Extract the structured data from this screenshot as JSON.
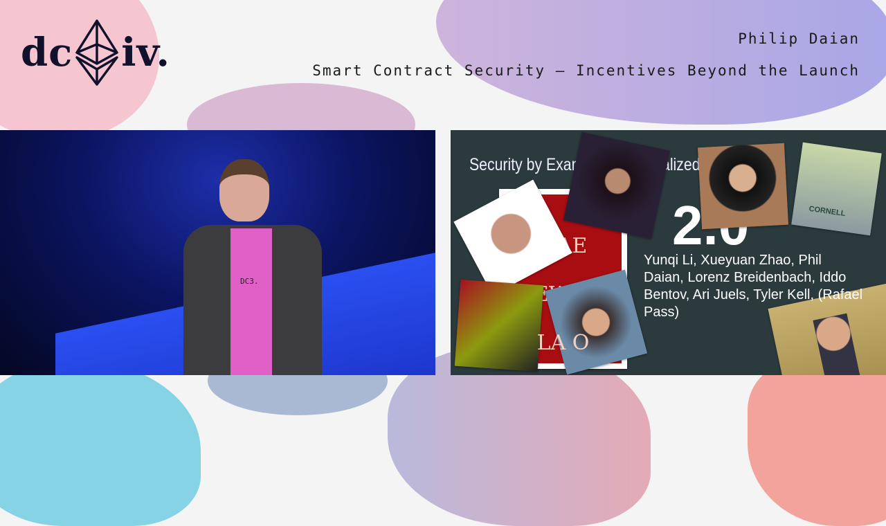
{
  "header": {
    "speaker": "Philip Daian",
    "talk_title": "Smart Contract Security – Incentives Beyond the Launch"
  },
  "logo": {
    "text_left": "dc",
    "text_right": "iv.",
    "icon": "ethereum-diamond-icon"
  },
  "video": {
    "shirt_text": "DC3."
  },
  "slide": {
    "title": "Security by Exam",
    "title_fragment": "alized",
    "number": "2.0",
    "authors": "Yunqi Li, Xueyuan Zhao, Phil Daian, Lorenz Breidenbach, Iddo Bentov, Ari Juels, Tyler Kell, (Rafael Pass)",
    "book_text_1": "HAE",
    "book_text_2": "EWIS",
    "book_text_3": "LA O",
    "shirt_text": "CORNELL"
  },
  "colors": {
    "slide_bg": "#2b3a3d",
    "stage_blue": "#1d2ea8",
    "shirt_pink": "#e060c8",
    "logo_ink": "#12112b"
  }
}
